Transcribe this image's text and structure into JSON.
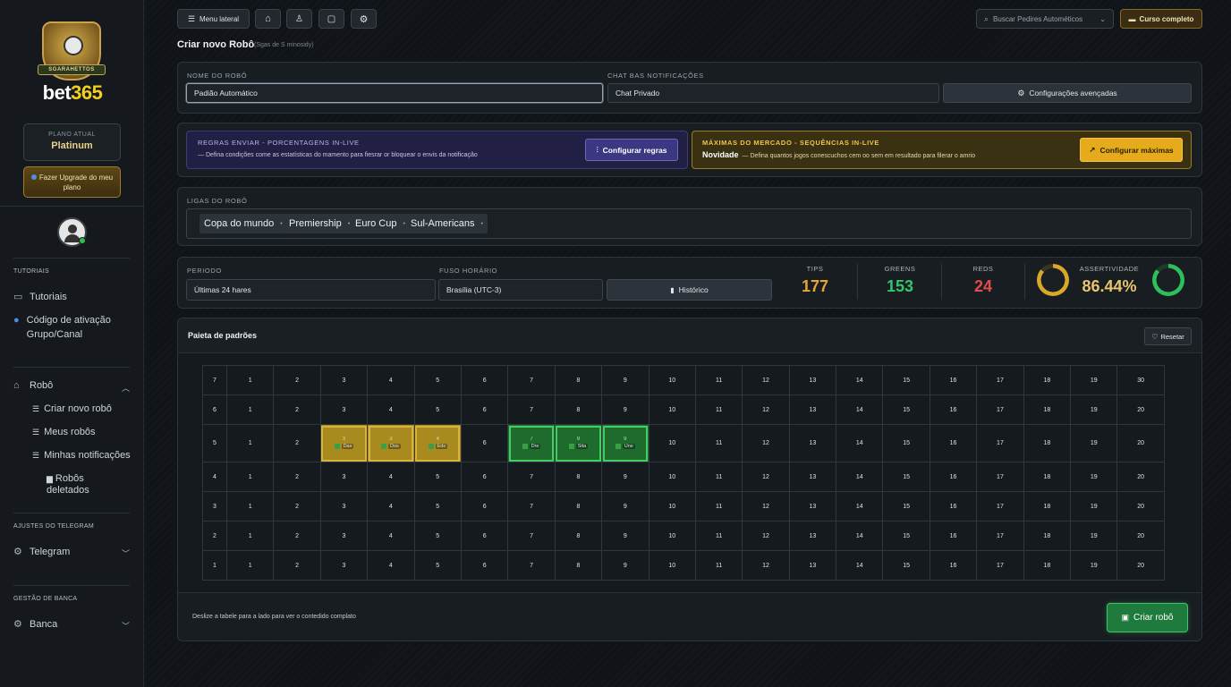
{
  "sidebar": {
    "logo_banner": "SGARAHETTOS",
    "logo_text_main": "bet",
    "logo_text_num": "365",
    "plan_label": "PLANO ATUAL",
    "plan_name": "Platinum",
    "upgrade_label": "Fazer Upgrade do meu plano",
    "sections": {
      "tutoriais": "TUTORIAIS",
      "telegram": "AJUSTES DO TELEGRAM",
      "banca": "GESTÃO DE BANCA"
    },
    "items": {
      "tutoriais": "Tutoriais",
      "codigo": "Código de ativação Grupo/Canal",
      "robo": "Robô",
      "criar": "Criar novo robô",
      "meus": "Meus robôs",
      "notificacoes": "Minhas notificações",
      "deletados": "Robôs deletados",
      "telegram": "Telegram",
      "banca": "Banca"
    }
  },
  "topbar": {
    "menu_label": "Menu lateral",
    "search_placeholder": "Buscar Pedires Autométicos",
    "curso_label": "Curso completo"
  },
  "page": {
    "title": "Criar novo Robô",
    "subtitle": "(Sgas de S minosidy)"
  },
  "form": {
    "nome_label": "NOME DO ROBÔ",
    "nome_value": "Padião Automático",
    "chat_label": "CHAT BAS NOTIFICAÇÕES",
    "chat_value": "Chat Privado",
    "config_adv_label": "Configurações avençadas"
  },
  "rules": {
    "title": "REGRAS ENVIAR - PORCENTAGENS IN-LIVE",
    "desc": "— Defina condições come as estatísticas do mamento para fiesrar or bloquear o envis da notificação",
    "button": "Configurar regras"
  },
  "maximas": {
    "title": "MÁXIMAS DO MERCADO - SEQUÊNCIAS IN-LIVE",
    "badge": "Novidade",
    "desc": "— Defina quantos jogos conescuchos cem oo sem em resultado para filerar o amrio",
    "button": "Configurar máximas"
  },
  "leagues": {
    "label": "LIGAS DO ROBÔ",
    "chips": [
      "Copa do mundo",
      "Premiership",
      "Euro Cup",
      "Sul-Americans"
    ]
  },
  "stats": {
    "periodo_label": "PERIODO",
    "periodo_value": "Últimas 24 hares",
    "fuso_label": "FUSO HORÁRIO",
    "fuso_value": "Brasília (UTC-3)",
    "historico_label": "Histórico",
    "tips_label": "TIPS",
    "tips_value": "177",
    "greens_label": "GREENS",
    "greens_value": "153",
    "reds_label": "REDS",
    "reds_value": "24",
    "assert_label": "ASSERTIVIDADE",
    "assert_value": "86.44%",
    "assert_fraction": 0.8644,
    "colors": {
      "tips": "#e8a531",
      "greens": "#35c46a",
      "reds": "#e34a4a",
      "gold": "#d9a72a",
      "green": "#2fbf5a"
    }
  },
  "grid": {
    "title": "Paieta de padrões",
    "reset_label": "Resetar",
    "footer_hint": "Deslize a tabele para a lado para ver o contedido complato",
    "create_label": "Criar robô",
    "rows": [
      {
        "label": "7",
        "cells": [
          "1",
          "2",
          "3",
          "4",
          "5",
          "6",
          "7",
          "8",
          "9",
          "10",
          "11",
          "12",
          "13",
          "14",
          "15",
          "16",
          "17",
          "18",
          "19",
          "30"
        ]
      },
      {
        "label": "6",
        "cells": [
          "1",
          "2",
          "3",
          "4",
          "5",
          "6",
          "7",
          "8",
          "9",
          "10",
          "11",
          "12",
          "13",
          "14",
          "15",
          "16",
          "17",
          "18",
          "19",
          "20"
        ]
      },
      {
        "label": "5",
        "cells": [
          "1",
          "2",
          "3",
          "3",
          "4",
          "6",
          "7",
          "9",
          "9",
          "10",
          "11",
          "12",
          "13",
          "14",
          "15",
          "16",
          "17",
          "18",
          "19",
          "20"
        ]
      },
      {
        "label": "4",
        "cells": [
          "1",
          "2",
          "3",
          "4",
          "5",
          "6",
          "7",
          "8",
          "9",
          "10",
          "11",
          "12",
          "13",
          "14",
          "15",
          "16",
          "17",
          "18",
          "19",
          "20"
        ]
      },
      {
        "label": "3",
        "cells": [
          "1",
          "2",
          "3",
          "4",
          "5",
          "6",
          "7",
          "8",
          "9",
          "10",
          "11",
          "12",
          "13",
          "14",
          "15",
          "16",
          "17",
          "18",
          "19",
          "20"
        ]
      },
      {
        "label": "2",
        "cells": [
          "1",
          "2",
          "3",
          "4",
          "5",
          "6",
          "7",
          "8",
          "9",
          "10",
          "11",
          "12",
          "13",
          "14",
          "15",
          "16",
          "17",
          "18",
          "19",
          "20"
        ]
      },
      {
        "label": "1",
        "cells": [
          "1",
          "2",
          "3",
          "4",
          "5",
          "6",
          "7",
          "8",
          "9",
          "10",
          "11",
          "12",
          "13",
          "14",
          "15",
          "16",
          "17",
          "18",
          "19",
          "20"
        ]
      }
    ],
    "highlighted": [
      {
        "row": 2,
        "col": 2,
        "kind": "y",
        "tag": "Das"
      },
      {
        "row": 2,
        "col": 3,
        "kind": "y",
        "tag": "Dos"
      },
      {
        "row": 2,
        "col": 4,
        "kind": "y",
        "tag": "Eds"
      },
      {
        "row": 2,
        "col": 6,
        "kind": "g",
        "tag": "Dre"
      },
      {
        "row": 2,
        "col": 7,
        "kind": "g",
        "tag": "Sita"
      },
      {
        "row": 2,
        "col": 8,
        "kind": "g",
        "tag": "Une"
      }
    ]
  }
}
